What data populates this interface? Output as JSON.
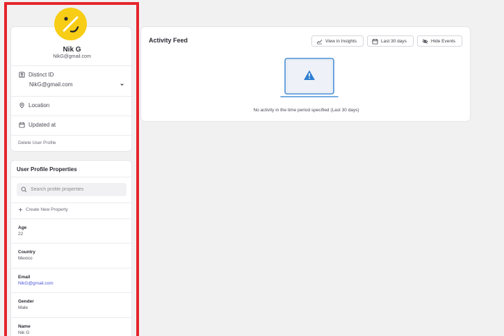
{
  "profile": {
    "name": "Nik G",
    "email": "NikG@gmail.com",
    "distinct_id_label": "Distinct ID",
    "distinct_id_value": "NikG@gmail.com",
    "location_label": "Location",
    "updated_label": "Updated at",
    "delete_label": "Delete User Profile"
  },
  "properties": {
    "title": "User Profile Properties",
    "search_placeholder": "Search profile properties",
    "create_label": "Create New Property",
    "items": [
      {
        "key": "Age",
        "value": "22"
      },
      {
        "key": "Country",
        "value": "Mexico"
      },
      {
        "key": "Email",
        "value": "NikG@gmail.com"
      },
      {
        "key": "Gender",
        "value": "Male"
      },
      {
        "key": "Name",
        "value": "Nik G"
      }
    ]
  },
  "activity": {
    "title": "Activity Feed",
    "view_insights_label": "View in Insights",
    "last_days_label": "Last 30 days",
    "hide_events_label": "Hide Events",
    "empty_message": "No activity in the time period specified (Last 30 days)"
  },
  "colors": {
    "highlight": "#e5242c",
    "avatar": "#f7cd16",
    "laptop": "#4a90d6",
    "link": "#4a55d8"
  },
  "icons": [
    "id-card-icon",
    "location-pin-icon",
    "calendar-icon",
    "chevron-down-icon",
    "search-icon",
    "plus-icon",
    "line-chart-icon",
    "eye-slash-icon",
    "laptop-warning-icon"
  ]
}
